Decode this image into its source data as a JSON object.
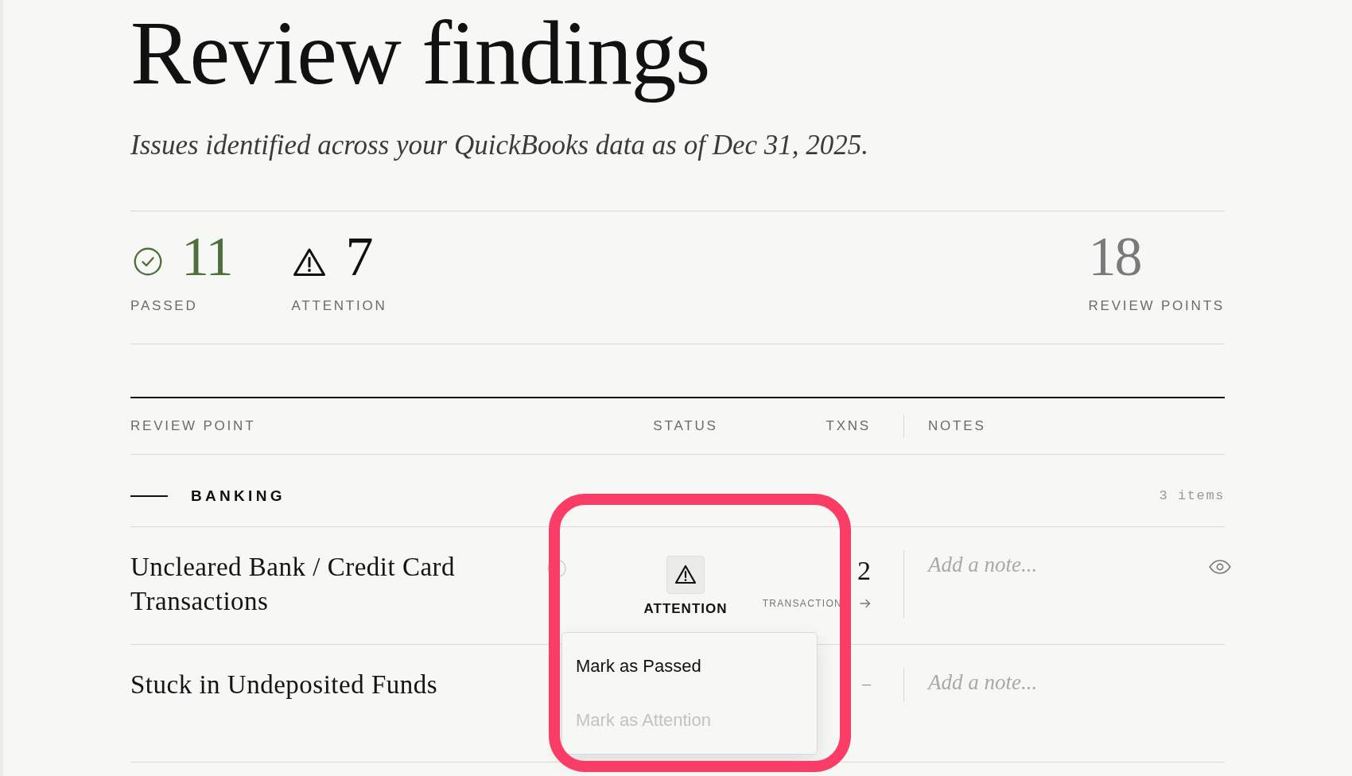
{
  "page": {
    "title": "Review findings",
    "subtitle": "Issues identified across your QuickBooks data as of Dec 31, 2025."
  },
  "summary": [
    {
      "kind": "passed",
      "count": "11",
      "label": "PASSED"
    },
    {
      "kind": "attention",
      "count": "7",
      "label": "ATTENTION"
    },
    {
      "kind": "total",
      "count": "18",
      "label": "REVIEW POINTS"
    }
  ],
  "table": {
    "columns": [
      {
        "label": "REVIEW POINT"
      },
      {
        "label": "STATUS"
      },
      {
        "label": "TXNS"
      },
      {
        "label": "NOTES"
      }
    ],
    "groups": [
      {
        "label": "BANKING",
        "count": "3 items",
        "rows": [
          {
            "title": "Uncleared Bank / Credit Card Transactions",
            "status": {
              "kind": "attention",
              "label": "ATTENTION"
            },
            "txns": {
              "kind": "count",
              "value": "2",
              "link": "TRANSACTION"
            },
            "note": {
              "placeholder": "Add a note..."
            },
            "view_button": true,
            "menu": {
              "items": [
                {
                  "label": "Mark as Passed",
                  "disabled": false
                },
                {
                  "label": "Mark as Attention",
                  "disabled": true
                }
              ]
            },
            "highlighted": true
          },
          {
            "title": "Stuck in Undeposited Funds",
            "txns": {
              "kind": "none",
              "value": "–"
            },
            "note": {
              "placeholder": "Add a note..."
            },
            "view_button": false,
            "highlighted": false
          }
        ]
      }
    ]
  }
}
